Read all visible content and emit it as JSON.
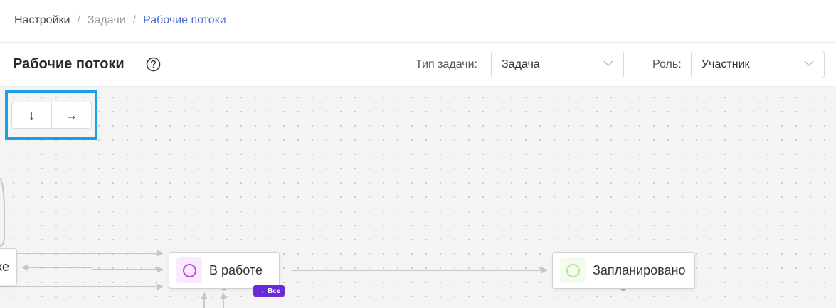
{
  "breadcrumb": {
    "item1": "Настройки",
    "separator": "/",
    "item2": "Задачи",
    "item3": "Рабочие потоки"
  },
  "header": {
    "title": "Рабочие потоки"
  },
  "filters": {
    "task_type_label": "Тип задачи:",
    "task_type_value": "Задача",
    "role_label": "Роль:",
    "role_value": "Участник"
  },
  "direction_controls": {
    "vertical_glyph": "↓",
    "horizontal_glyph": "→"
  },
  "nodes": {
    "partial": "ке",
    "in_progress": "В работе",
    "planned": "Запланировано"
  },
  "badge": {
    "arrow": "→",
    "label": "Все"
  },
  "colors": {
    "accent_blue": "#4a6fd0",
    "highlight": "#1aa0e6",
    "in_progress_ring": "#b44fe0",
    "in_progress_bg": "#fbeafd",
    "planned_ring": "#b7e59a",
    "planned_bg": "#f3fbee",
    "badge_bg": "#6b2ad8"
  }
}
